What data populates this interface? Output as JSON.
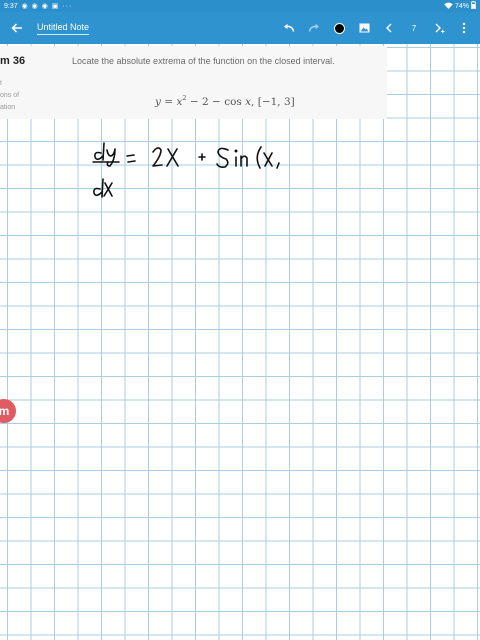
{
  "status_bar": {
    "time": "9:37",
    "icons": "◉ ◉ ◉ ▣ ···",
    "battery": "74%"
  },
  "toolbar": {
    "note_title": "Untitled Note",
    "page_number": "7"
  },
  "question": {
    "problem_label": "m 36",
    "side_lines": [
      "t",
      "ons of",
      "ation"
    ],
    "text": "Locate the absolute extrema of the function on the closed interval.",
    "formula": {
      "y": "y",
      "x": "x",
      "exp": "2",
      "two": "2",
      "cos": "cos",
      "interval": "[−1, 3]"
    }
  },
  "handwriting": "dy/dx = 2x + sin(x",
  "logo": {
    "letter": "m"
  }
}
